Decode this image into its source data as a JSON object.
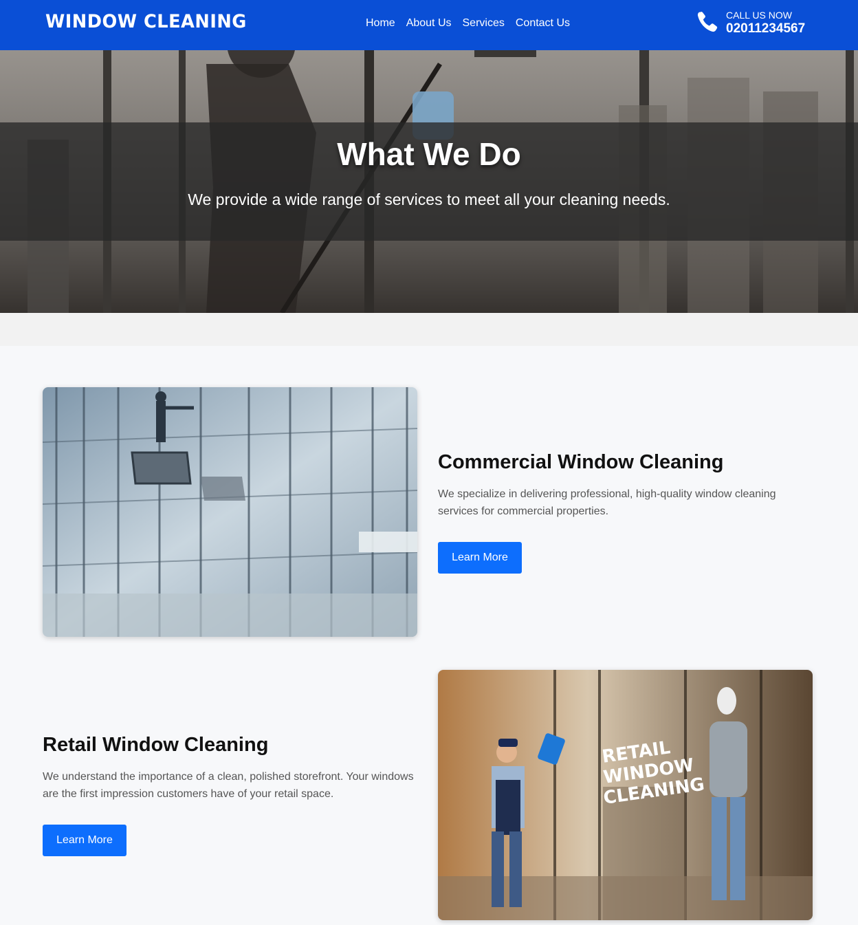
{
  "header": {
    "logo": "WINDOW CLEANING",
    "nav": [
      "Home",
      "About Us",
      "Services",
      "Contact Us"
    ],
    "call_label": "CALL US NOW",
    "call_number": "02011234567",
    "brand_color": "#0a4fd6"
  },
  "hero": {
    "title": "What We Do",
    "subtitle": "We provide a wide range of services to meet all your cleaning needs."
  },
  "services": [
    {
      "title": "Commercial Window Cleaning",
      "text": "We specialize in delivering professional, high-quality window cleaning services for commercial properties.",
      "button": "Learn More"
    },
    {
      "title": "Retail Window Cleaning",
      "text": "We understand the importance of a clean, polished storefront. Your windows are the first impression customers have of your retail space.",
      "button": "Learn More",
      "image_sign": "RETAIL WINDOW CLEANING"
    }
  ],
  "icons": {
    "phone": "phone-icon"
  },
  "colors": {
    "button": "#0d6efd"
  }
}
